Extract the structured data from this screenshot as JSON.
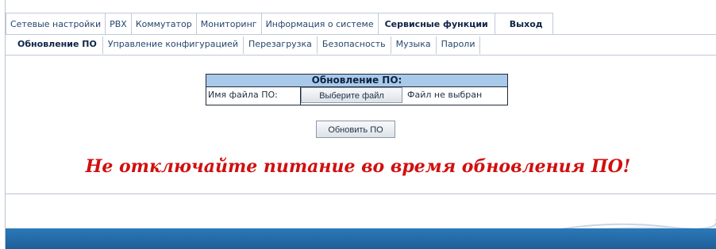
{
  "nav": {
    "main_tabs": [
      {
        "label": "Сетевые настройки",
        "active": false
      },
      {
        "label": "PBX",
        "active": false
      },
      {
        "label": "Коммутатор",
        "active": false
      },
      {
        "label": "Мониторинг",
        "active": false
      },
      {
        "label": "Информация о системе",
        "active": false
      },
      {
        "label": "Сервисные функции",
        "active": true
      },
      {
        "label": "Выход",
        "active": false
      }
    ],
    "sub_tabs": [
      {
        "label": "Обновление ПО",
        "active": true
      },
      {
        "label": "Управление конфигурацией",
        "active": false
      },
      {
        "label": "Перезагрузка",
        "active": false
      },
      {
        "label": "Безопасность",
        "active": false
      },
      {
        "label": "Музыка",
        "active": false
      },
      {
        "label": "Пароли",
        "active": false
      }
    ]
  },
  "update_form": {
    "title": "Обновление ПО:",
    "file_label": "Имя файла ПО:",
    "file_button": "Выберите файл",
    "file_status": "Файл не выбран",
    "submit_label": "Обновить ПО"
  },
  "warning": "Не отключайте питание во время обновления ПО!",
  "colors": {
    "header_fill": "#a8c9ea",
    "warning": "#d10f0f",
    "bottom_bar": "#2c79b8"
  }
}
